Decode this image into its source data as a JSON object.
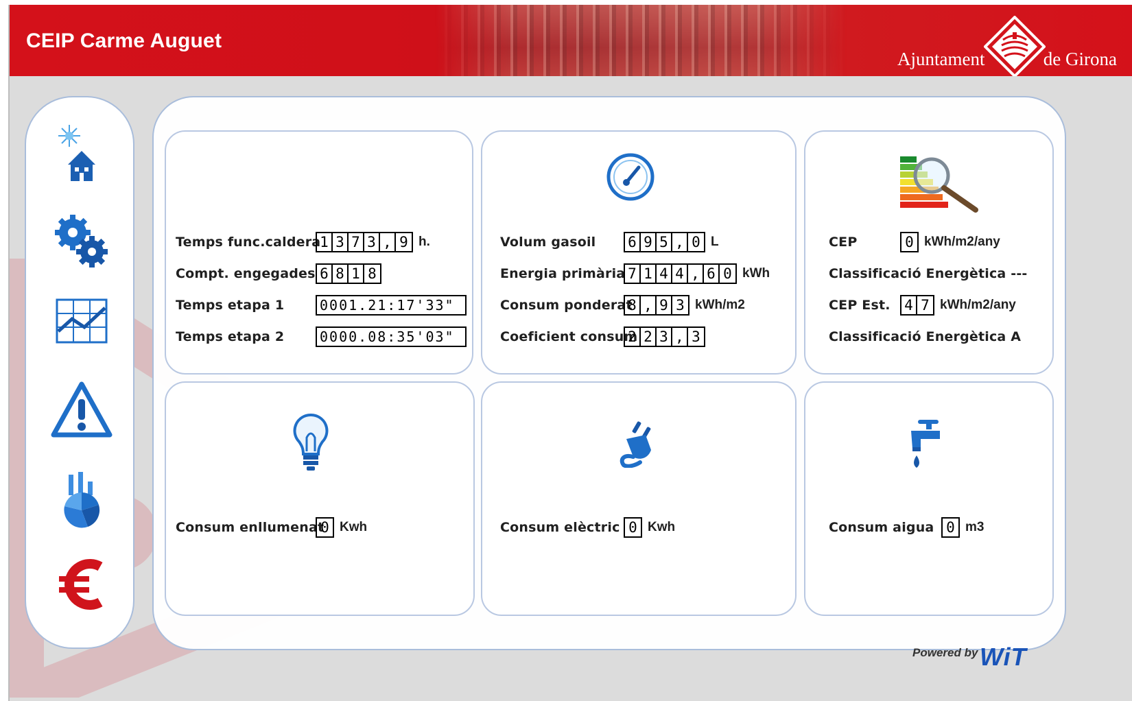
{
  "header": {
    "title": "CEIP Carme Auguet",
    "brand_left": "Ajuntament",
    "brand_right": "de Girona"
  },
  "nav": [
    {
      "name": "climate-home",
      "icon": "sun-house-icon"
    },
    {
      "name": "settings",
      "icon": "gears-icon"
    },
    {
      "name": "charts",
      "icon": "line-chart-icon"
    },
    {
      "name": "alarms",
      "icon": "warning-icon"
    },
    {
      "name": "statistics",
      "icon": "pie-bar-chart-icon"
    },
    {
      "name": "costs",
      "icon": "euro-icon"
    }
  ],
  "boiler": {
    "icon": "none",
    "rows": [
      {
        "label": "Temps func.caldera",
        "digits": [
          "1",
          "3",
          "7",
          "3",
          ",",
          "9"
        ],
        "unit": "h."
      },
      {
        "label": "Compt. engegades",
        "digits": [
          "6",
          "8",
          "1",
          "8"
        ],
        "unit": ""
      },
      {
        "label": "Temps etapa 1",
        "timer": "0001.21:17'33\""
      },
      {
        "label": "Temps etapa 2",
        "timer": "0000.08:35'03\""
      }
    ]
  },
  "fuel": {
    "icon": "gauge-icon",
    "rows": [
      {
        "label": "Volum gasoil",
        "digits": [
          "6",
          "9",
          "5",
          ",",
          "0"
        ],
        "unit": "L"
      },
      {
        "label": "Energia primària",
        "digits": [
          "7",
          "1",
          "4",
          "4",
          ",",
          "6",
          "0"
        ],
        "unit": "kWh"
      },
      {
        "label": "Consum ponderat",
        "digits": [
          "8",
          ",",
          "9",
          "3"
        ],
        "unit": "kWh/m2"
      },
      {
        "label": "Coeficient consum",
        "digits": [
          "2",
          "2",
          "3",
          ",",
          "3"
        ],
        "unit": ""
      }
    ]
  },
  "energy_rating": {
    "icon": "energy-label-magnifier-icon",
    "rows": [
      {
        "label": "CEP",
        "digits": [
          "0"
        ],
        "unit": "kWh/m2/any"
      },
      {
        "label": "Classificació Energètica ---"
      },
      {
        "label": "CEP Est.",
        "digits": [
          "4",
          "7"
        ],
        "unit": "kWh/m2/any"
      },
      {
        "label": "Classificació Energètica A"
      }
    ]
  },
  "lighting": {
    "icon": "lightbulb-icon",
    "label": "Consum enllumenat",
    "digits": [
      "0"
    ],
    "unit": "Kwh"
  },
  "electric": {
    "icon": "plug-icon",
    "label": "Consum elèctric",
    "digits": [
      "0"
    ],
    "unit": "Kwh"
  },
  "water": {
    "icon": "faucet-icon",
    "label": "Consum aigua",
    "digits": [
      "0"
    ],
    "unit": "m3"
  },
  "footer": {
    "powered_by": "Powered by",
    "brand": "WiT"
  },
  "colors": {
    "header_red": "#d4111a",
    "icon_blue": "#1f6fc8",
    "border_blue": "#a9bddb",
    "euro_red": "#d0141c"
  }
}
